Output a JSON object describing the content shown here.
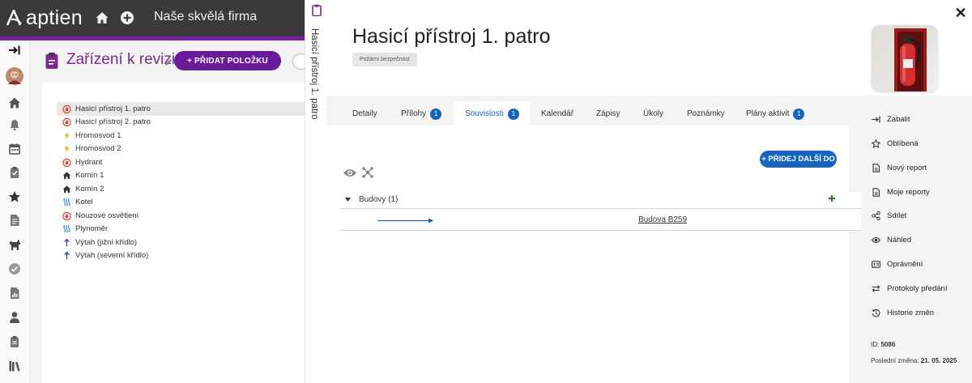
{
  "topbar": {
    "logo": "aptien",
    "company": "Naše skvělá firma",
    "icons": [
      "app-logo-mark-icon",
      "home-icon",
      "add-circle-icon"
    ]
  },
  "rail": {
    "icons": [
      "collapse-menu-icon",
      "avatar",
      "home-icon",
      "bell-icon",
      "calendar-icon",
      "clipboard-icon",
      "star-icon",
      "document-icon",
      "dog-icon",
      "check-circle-icon",
      "report-icon",
      "person-icon",
      "clipboard-list-icon",
      "library-icon"
    ]
  },
  "list_panel": {
    "title": "Zařízení k revizi",
    "add_button": "+ PŘIDAT POLOŽKU",
    "items": [
      {
        "label": "Hasicí přístroj 1. patro",
        "icon": "fire-icon",
        "selected": true
      },
      {
        "label": "Hasicí přístroj 2. patro",
        "icon": "fire-icon"
      },
      {
        "label": "Hromosvod 1",
        "icon": "lightning-icon"
      },
      {
        "label": "Hromosvod 2",
        "icon": "lightning-icon"
      },
      {
        "label": "Hydrant",
        "icon": "fire-icon"
      },
      {
        "label": "Komín 1",
        "icon": "house-icon"
      },
      {
        "label": "Komín 2",
        "icon": "house-icon"
      },
      {
        "label": "Kotel",
        "icon": "heat-icon"
      },
      {
        "label": "Nouzové osvětlení",
        "icon": "fire-icon"
      },
      {
        "label": "Plynoměr",
        "icon": "heat-icon"
      },
      {
        "label": "Výtah (jižní křídlo)",
        "icon": "arrow-up-icon"
      },
      {
        "label": "Výtah (severní křídlo)",
        "icon": "arrow-up-icon"
      }
    ]
  },
  "side_strip": {
    "title": "Hasicí přístroj 1. patro"
  },
  "detail": {
    "title": "Hasicí přístroj 1. patro",
    "badge": "Požární bezpečnost",
    "tabs": [
      {
        "label": "Detaily"
      },
      {
        "label": "Přílohy",
        "count": "1"
      },
      {
        "label": "Souvislosti",
        "count": "1",
        "active": true
      },
      {
        "label": "Kalendář"
      },
      {
        "label": "Zápisy"
      },
      {
        "label": "Úkoly"
      },
      {
        "label": "Poznámky"
      },
      {
        "label": "Plány aktivit",
        "count": "1"
      }
    ],
    "add_button": "+ PŘIDEJ DALŠÍ DO",
    "group": {
      "label": "Budovy (1)"
    },
    "relation": {
      "label": "Budova B259"
    },
    "actions": [
      {
        "label": "Zabalit",
        "icon": "collapse-icon"
      },
      {
        "label": "Oblíbená",
        "icon": "star-outline-icon"
      },
      {
        "label": "Nový report",
        "icon": "document-icon"
      },
      {
        "label": "Moje reporty",
        "icon": "document-icon"
      },
      {
        "label": "Sdílet",
        "icon": "share-icon"
      },
      {
        "label": "Náhled",
        "icon": "eye-icon"
      },
      {
        "label": "Oprávnění",
        "icon": "id-card-icon"
      },
      {
        "label": "Protokoly předání",
        "icon": "handover-icon"
      },
      {
        "label": "Historie změn",
        "icon": "history-icon"
      }
    ],
    "info": {
      "id_label": "ID:",
      "id": "5086",
      "changed_label": "Poslední změna:",
      "changed": "21. 05. 2025"
    }
  },
  "colors": {
    "brand_purple": "#7b1fa2",
    "title_purple": "#7b2d8e",
    "accent_blue": "#1565c0",
    "fire_red": "#e53935",
    "lightning_orange": "#f9a825",
    "heat_blue": "#1e88e5",
    "add_green": "#2e7d32"
  }
}
